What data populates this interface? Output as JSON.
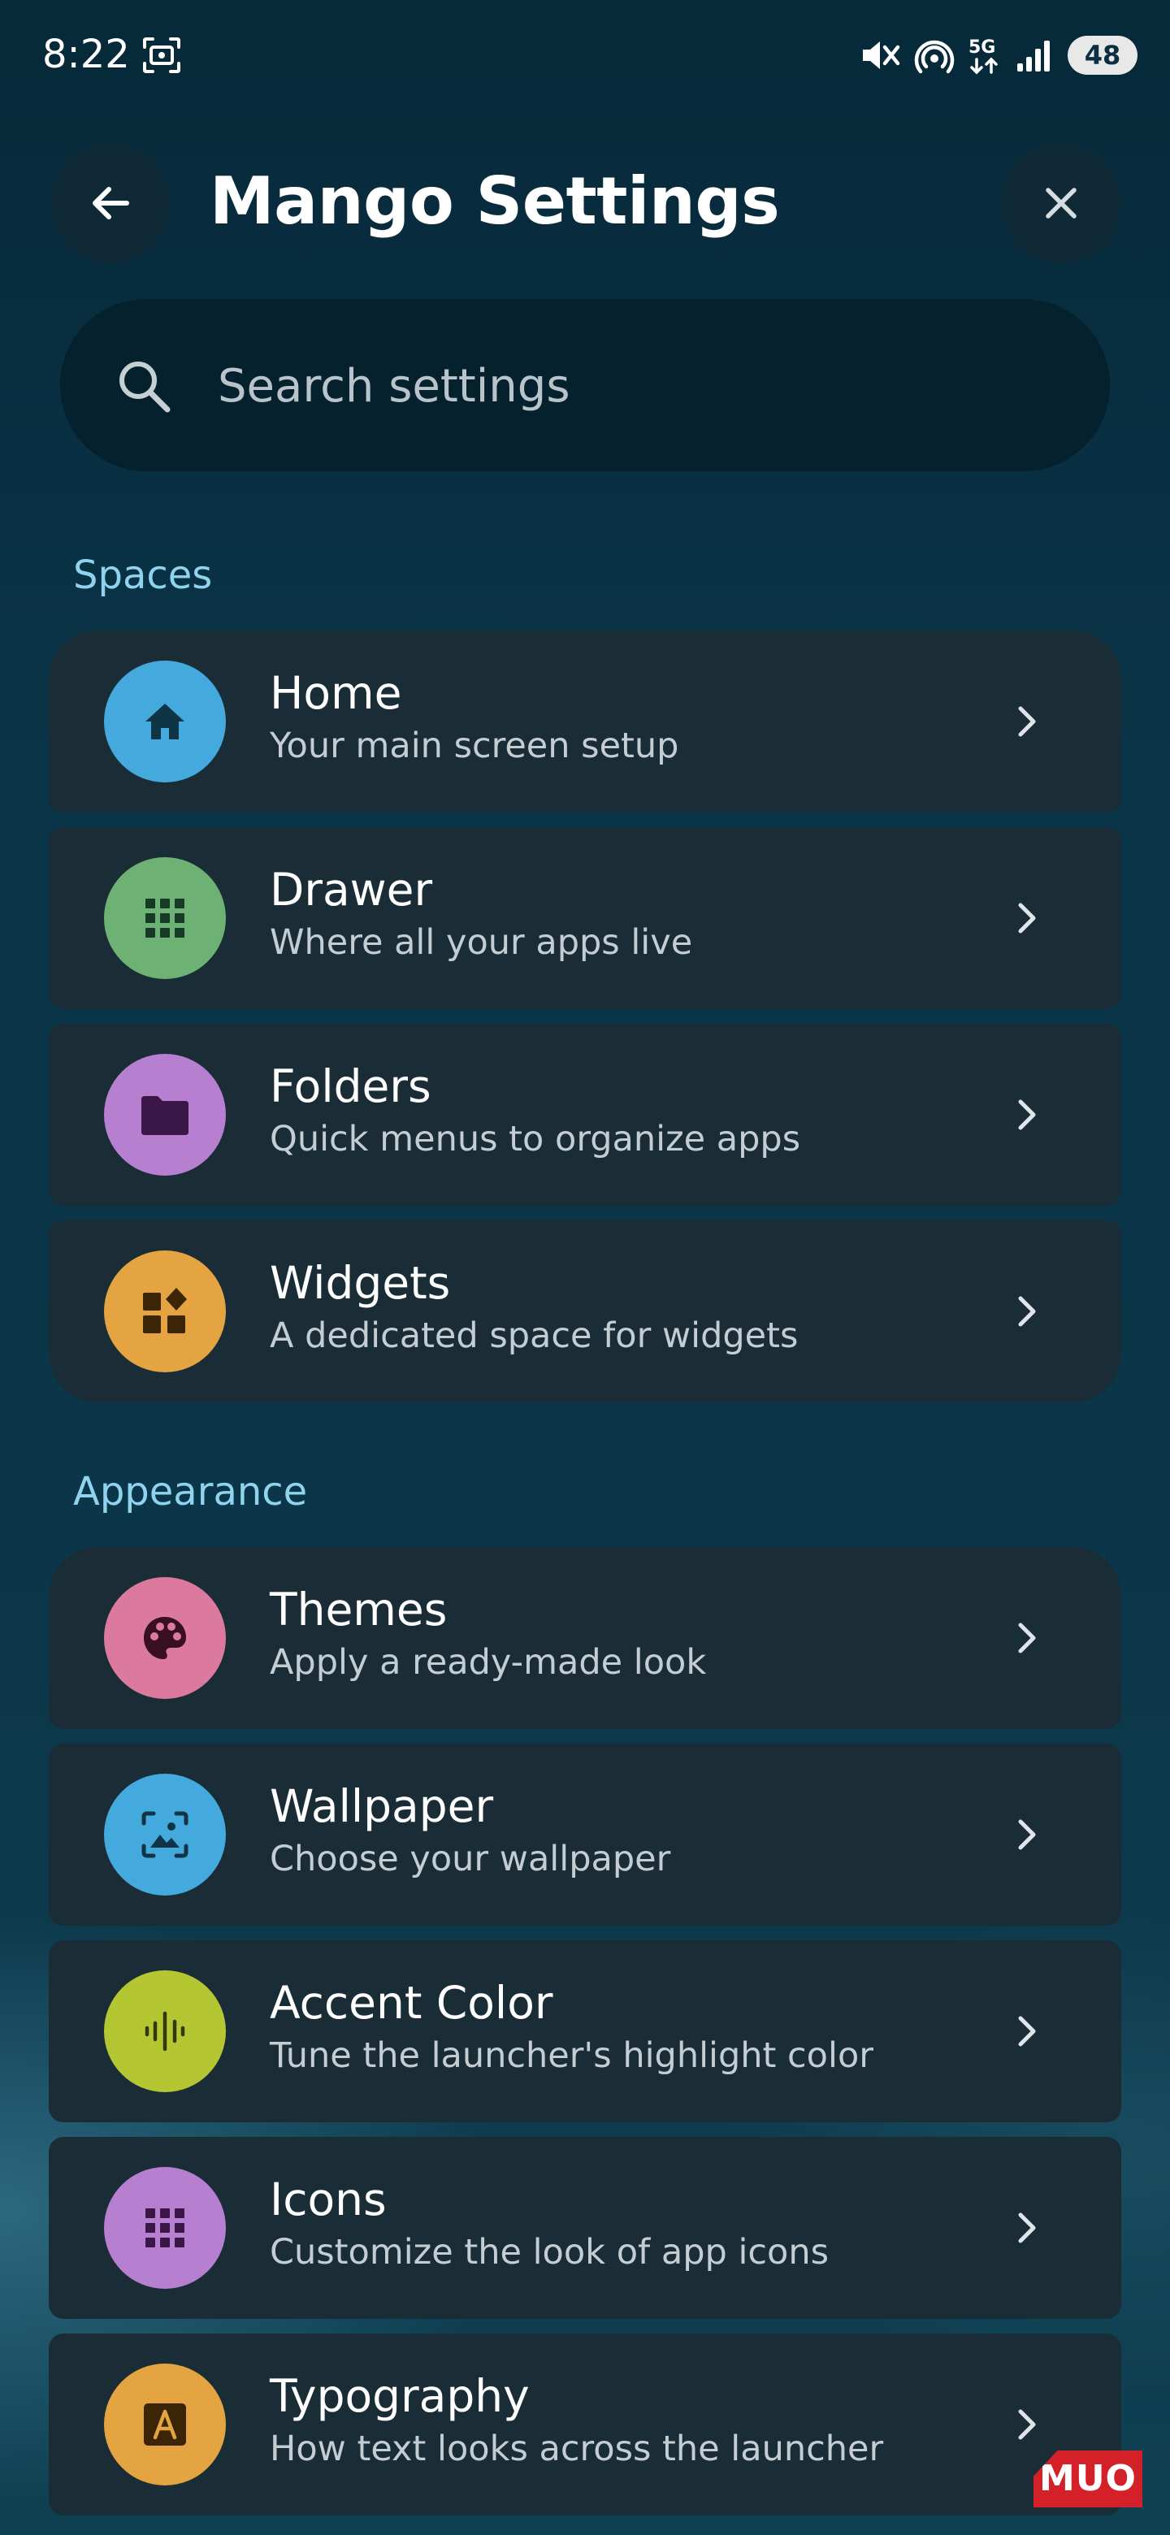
{
  "status_bar": {
    "time": "8:22",
    "battery": "48",
    "network": "5G",
    "icons": [
      "screenshot-icon",
      "mute-icon",
      "hotspot-icon",
      "5g-icon",
      "signal-icon",
      "battery-icon"
    ]
  },
  "header": {
    "title": "Mango Settings",
    "back_icon": "arrow-left-icon",
    "close_icon": "close-icon"
  },
  "search": {
    "placeholder": "Search settings",
    "value": ""
  },
  "sections": [
    {
      "header": "Spaces",
      "items": [
        {
          "title": "Home",
          "subtitle": "Your main screen setup",
          "icon": "home-icon",
          "color": "#44a9dc"
        },
        {
          "title": "Drawer",
          "subtitle": "Where all your apps live",
          "icon": "grid-icon",
          "color": "#6db274"
        },
        {
          "title": "Folders",
          "subtitle": "Quick menus to organize apps",
          "icon": "folder-icon",
          "color": "#b67fd0"
        },
        {
          "title": "Widgets",
          "subtitle": "A dedicated space for widgets",
          "icon": "widgets-icon",
          "color": "#e4a441"
        }
      ]
    },
    {
      "header": "Appearance",
      "items": [
        {
          "title": "Themes",
          "subtitle": "Apply a ready-made look",
          "icon": "palette-icon",
          "color": "#dc7a9e"
        },
        {
          "title": "Wallpaper",
          "subtitle": "Choose your wallpaper",
          "icon": "wallpaper-icon",
          "color": "#44a9dc"
        },
        {
          "title": "Accent Color",
          "subtitle": "Tune the launcher's highlight color",
          "icon": "waveform-icon",
          "color": "#b4c732"
        },
        {
          "title": "Icons",
          "subtitle": "Customize the look of app icons",
          "icon": "grid-icon",
          "color": "#b67fd0"
        },
        {
          "title": "Typography",
          "subtitle": "How text looks across the launcher",
          "icon": "font-icon",
          "color": "#e4a441"
        }
      ]
    }
  ],
  "watermark": "MUO"
}
